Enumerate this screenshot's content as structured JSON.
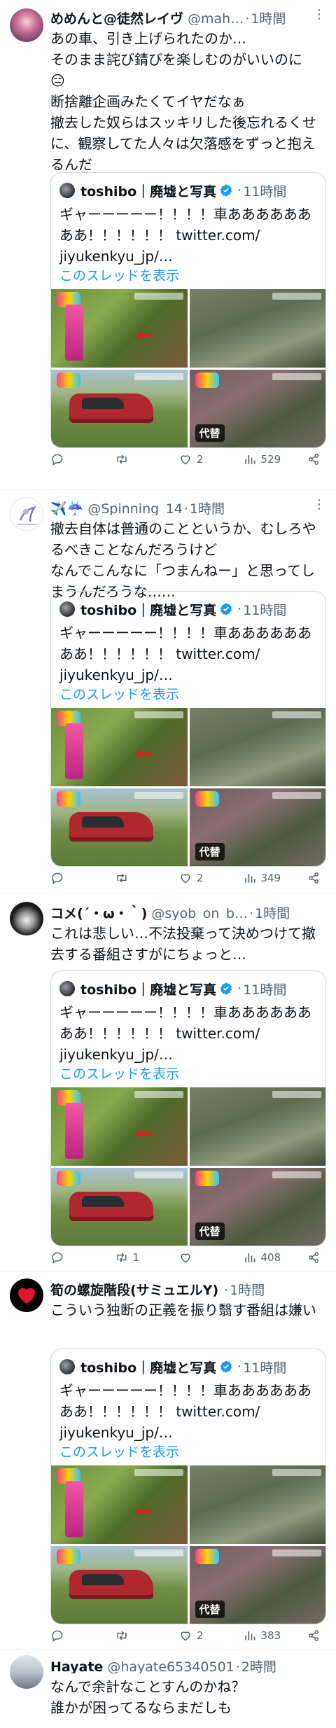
{
  "quote_card": {
    "author": "toshibo｜廃墟と写真",
    "time": "11時間",
    "text": "ギャーーーーー！！！！車ああああああああ！！！！！！ twitter.com/\njiyukenkyu_jp/…",
    "thread_link": "このスレッドを表示",
    "alt_badge": "代替"
  },
  "tweets": [
    {
      "name": "めめんと@徒然レイヴ",
      "handle": "@mah…",
      "sep": "·",
      "time": "1時間",
      "text": "あの車、引き上げられたのか…\nそのまま詫び錆びを楽しむのがいいのに\n😑\n断捨離企画みたくてイヤだなぁ\n撤去した奴らはスッキリした後忘れるくせに、観察してた人々は欠落感をずっと抱えるんだ",
      "replies": "",
      "retweets": "",
      "likes": "2",
      "views": "529"
    },
    {
      "name": "✈️☔️",
      "handle": "@Spinning_14",
      "sep": "·",
      "time": "1時間",
      "text": "撤去自体は普通のことというか、むしろやるべきことなんだろうけど\nなんでこんなに「つまんねー」と思ってしまうんだろうな……",
      "replies": "",
      "retweets": "",
      "likes": "2",
      "views": "349"
    },
    {
      "name": "コメ(´・ω・｀)",
      "handle": "@syob_on_b…",
      "sep": "·",
      "time": "1時間",
      "text": "これは悲しい…不法投棄って決めつけて撤去する番組さすがにちょっと…",
      "replies": "",
      "retweets": "1",
      "likes": "",
      "views": "408"
    },
    {
      "name": "筍の螺旋階段(サミュエルY)",
      "handle": "",
      "sep": "·",
      "time": "1時間",
      "text": "こういう独断の正義を振り翳す番組は嫌い",
      "replies": "",
      "retweets": "",
      "likes": "2",
      "views": "383"
    },
    {
      "name": "Hayate",
      "handle": "@hayate65340501",
      "sep": "·",
      "time": "2時間",
      "text": "なんで余計なことすんのかね？\n誰かが困ってるならまだしも"
    }
  ],
  "colors": {
    "text": "#0f1419",
    "muted": "#536471",
    "link": "#1d9bf0",
    "border": "#cfd9de"
  },
  "icons": [
    "more-icon",
    "verified-icon",
    "reply-icon",
    "retweet-icon",
    "like-icon",
    "views-icon",
    "share-icon"
  ]
}
